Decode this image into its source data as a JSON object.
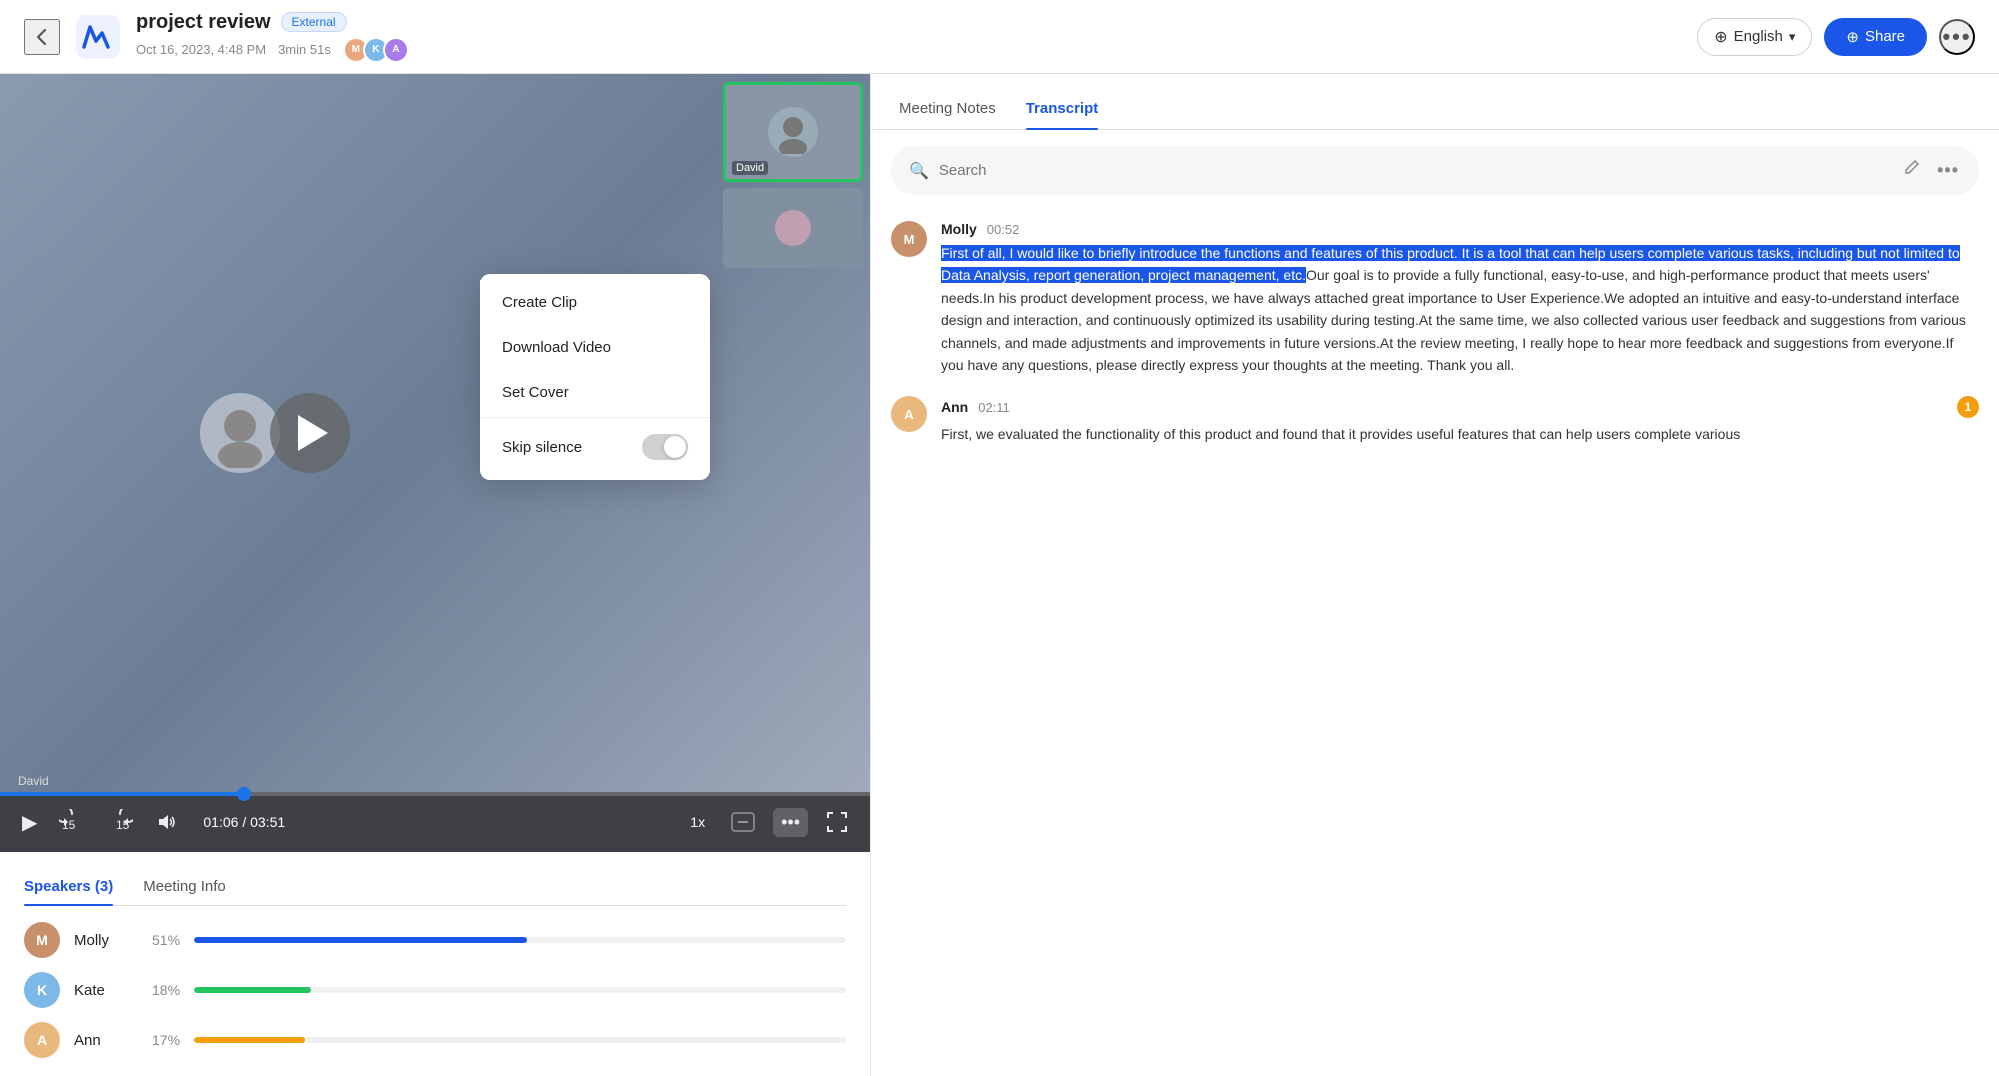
{
  "header": {
    "back_label": "←",
    "title": "project review",
    "badge": "External",
    "date": "Oct 16, 2023, 4:48 PM",
    "duration": "3min 51s",
    "lang_label": "English",
    "share_label": "Share",
    "more_label": "•••"
  },
  "video": {
    "speaker_label": "David",
    "time_current": "01:06",
    "time_total": "03:51",
    "speed": "1x",
    "progress_pct": 28
  },
  "context_menu": {
    "items": [
      "Create Clip",
      "Download Video",
      "Set Cover"
    ],
    "skip_silence_label": "Skip silence"
  },
  "speakers_tab": {
    "label": "Speakers (3)",
    "meeting_info_label": "Meeting Info",
    "speakers": [
      {
        "name": "Molly",
        "pct": "51%",
        "bar_color": "#1a56e8",
        "bar_width": "51%"
      },
      {
        "name": "Kate",
        "pct": "18%",
        "bar_color": "#22c55e",
        "bar_width": "18%"
      },
      {
        "name": "Ann",
        "pct": "17%",
        "bar_color": "#f59e0b",
        "bar_width": "17%"
      }
    ]
  },
  "right_panel": {
    "tabs": [
      "Meeting Notes",
      "Transcript"
    ],
    "active_tab": "Transcript",
    "search_placeholder": "Search",
    "transcript": [
      {
        "speaker": "Molly",
        "time": "00:52",
        "highlighted": "First of all, I would like to briefly introduce the functions and features of this product. It is a tool that can help users complete various tasks, including but not limited to Data Analysis, report generation, project management, etc.",
        "normal": "Our goal is to provide a fully functional, easy-to-use, and high-performance product that meets users' needs.In his product development process, we have always attached great importance to User Experience.We adopted an intuitive and easy-to-understand interface design and interaction, and continuously optimized its usability during testing.At the same time, we also collected various user feedback and suggestions from various channels, and made adjustments and improvements in future versions.At the review meeting, I really hope to hear more feedback and suggestions from everyone.If you have any questions, please directly express your thoughts at the meeting. Thank you all."
      },
      {
        "speaker": "Ann",
        "time": "02:11",
        "highlighted": "",
        "normal": "First, we evaluated the functionality of this product and found that it provides useful features that can help users complete various",
        "has_badge": true,
        "badge_count": "1"
      }
    ]
  },
  "icons": {
    "back": "‹",
    "play": "▶",
    "rewind": "↺",
    "forward": "↻",
    "volume": "🔊",
    "captions": "CC",
    "more": "•••",
    "fullscreen": "⛶",
    "search": "🔍",
    "edit": "✏",
    "globe": "⊕"
  },
  "colors": {
    "accent": "#1a56e8",
    "green": "#22c55e",
    "amber": "#f59e0b"
  }
}
